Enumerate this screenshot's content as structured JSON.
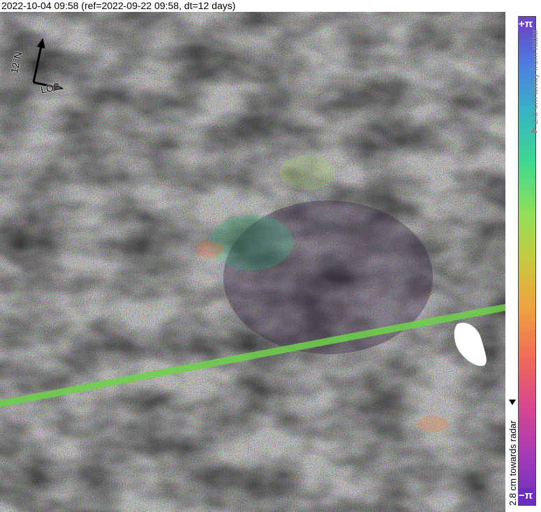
{
  "header": {
    "title": "2022-10-04 09:58 (ref=2022-09-22 09:58, dt=12 days)"
  },
  "map": {
    "compass": {
      "north_label": "12°N",
      "los_label": "LOS"
    }
  },
  "colorbar": {
    "top_label": "+π",
    "bottom_label": "−π",
    "upper_text": "2.8 cm away from radar",
    "lower_text": "2.8 cm towards radar",
    "gradient": [
      "#6a3fc6",
      "#4c7fe0",
      "#36b7c4",
      "#3fd88f",
      "#8fe05a",
      "#c8c83c",
      "#f0a040",
      "#f06a58",
      "#d8478f",
      "#a43ab8",
      "#6a2fbf"
    ]
  }
}
